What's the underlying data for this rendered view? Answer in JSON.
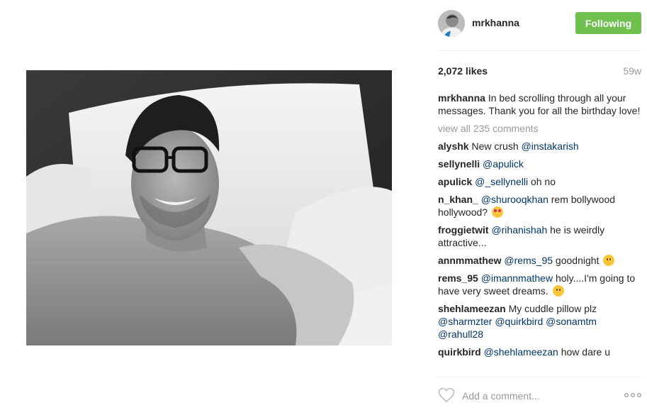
{
  "post": {
    "author": "mrkhanna",
    "follow_label": "Following",
    "likes": "2,072 likes",
    "time": "59w",
    "caption": {
      "user": "mrkhanna",
      "text": "In bed scrolling through all your messages. Thank you for all the birthday love!"
    },
    "view_all": "view all 235 comments",
    "comments": [
      {
        "user": "alyshk",
        "text": "New crush ",
        "mention": "@instakarish",
        "after": ""
      },
      {
        "user": "sellynelli",
        "text": "",
        "mention": "@apulick",
        "after": ""
      },
      {
        "user": "apulick",
        "text": "",
        "mention": "@_sellynelli",
        "after": " oh no"
      },
      {
        "user": "n_khan_",
        "text": "",
        "mention": "@shurooqkhan",
        "after": " rem bollywood hollywood? "
      },
      {
        "user": "froggietwit",
        "text": "",
        "mention": "@rihanishah",
        "after": " he is weirdly attractive..."
      },
      {
        "user": "annmmathew",
        "text": "",
        "mention": "@rems_95",
        "after": " goodnight "
      },
      {
        "user": "rems_95",
        "text": "",
        "mention": "@imannmathew",
        "after": " holy....I'm going to have very sweet dreams. "
      },
      {
        "user": "shehlameezan",
        "text": "My cuddle pillow plz ",
        "mention": "@sharmzter @quirkbird @sonamtm @rahull28",
        "after": ""
      },
      {
        "user": "quirkbird",
        "text": "",
        "mention": "@shehlameezan",
        "after": " how dare u"
      }
    ],
    "add_comment_placeholder": "Add a comment...",
    "icons": {
      "like": "heart-outline-icon",
      "more": "more-horizontal-icon"
    },
    "colors": {
      "follow_button": "#70c050",
      "mention": "#003569",
      "muted": "#999999"
    }
  }
}
